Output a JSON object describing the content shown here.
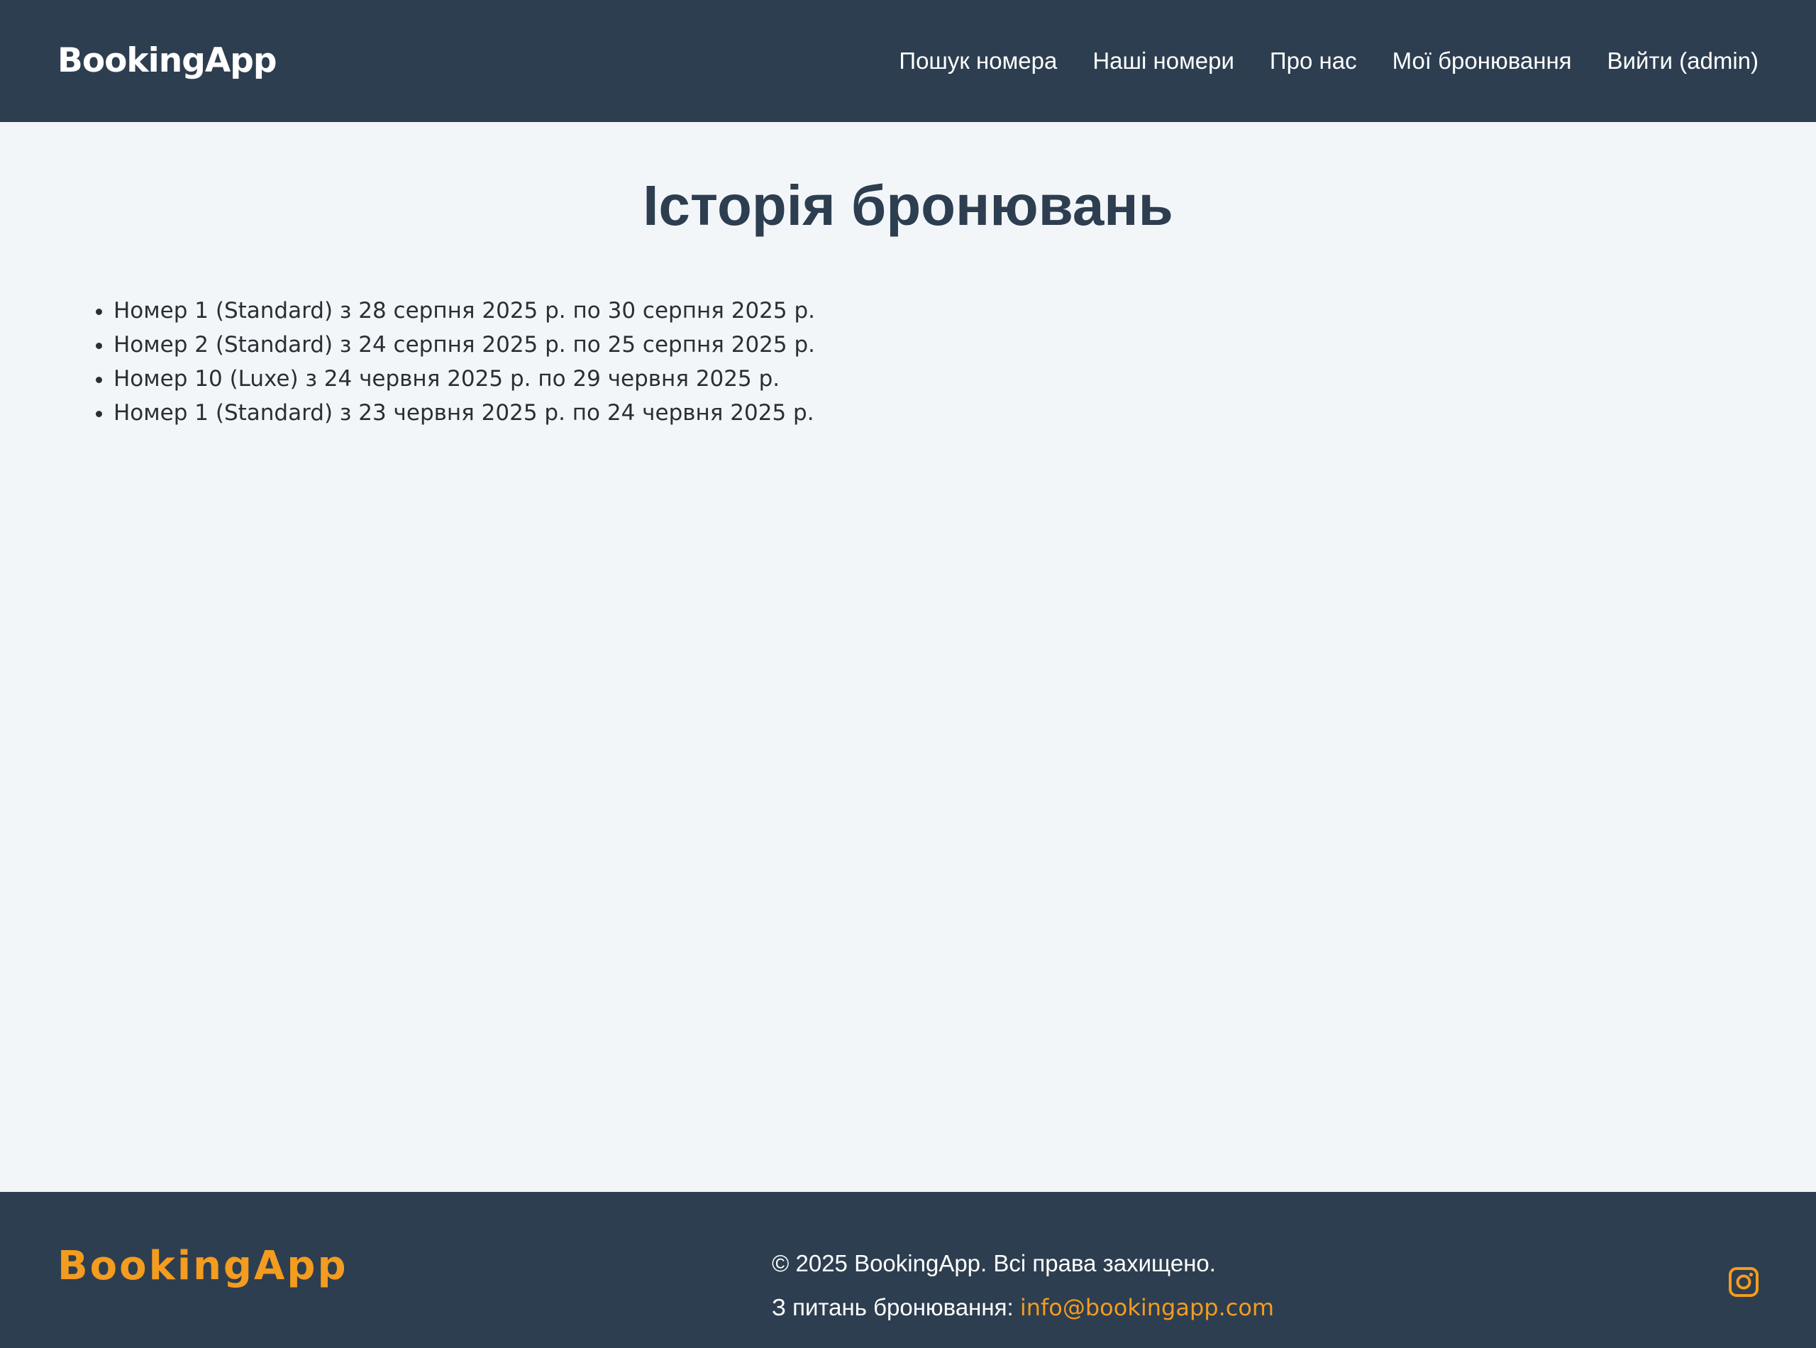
{
  "header": {
    "brand": "BookingApp",
    "nav": [
      {
        "label": "Пошук номера"
      },
      {
        "label": "Наші номери"
      },
      {
        "label": "Про нас"
      },
      {
        "label": "Мої бронювання"
      },
      {
        "label": "Вийти (admin)"
      }
    ]
  },
  "main": {
    "title": "Історія бронювань",
    "bookings": [
      "Номер 1 (Standard) з 28 серпня 2025 р. по 30 серпня 2025 р.",
      "Номер 2 (Standard) з 24 серпня 2025 р. по 25 серпня 2025 р.",
      "Номер 10 (Luxe) з 24 червня 2025 р. по 29 червня 2025 р.",
      "Номер 1 (Standard) з 23 червня 2025 р. по 24 червня 2025 р."
    ]
  },
  "footer": {
    "brand": "BookingApp",
    "copyright": "© 2025 BookingApp. Всі права захищено.",
    "contact_label": "З питань бронювання:",
    "email": "info@bookingapp.com",
    "social_icon": "instagram-icon"
  },
  "colors": {
    "header_bg": "#2d3e50",
    "page_bg": "#f3f6f9",
    "accent": "#f39c1f",
    "title": "#2d3e50"
  }
}
